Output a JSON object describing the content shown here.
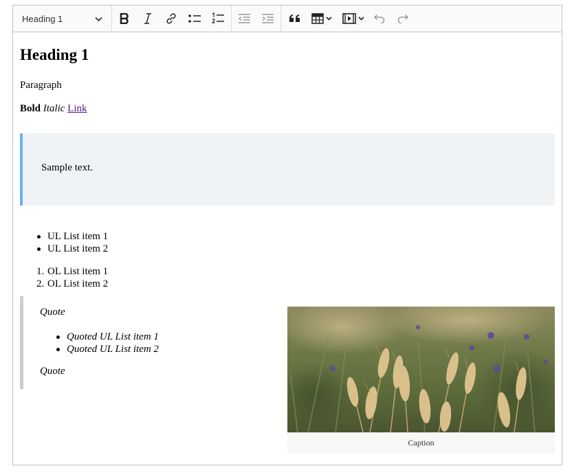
{
  "toolbar": {
    "heading_select": "Heading 1",
    "buttons": [
      "bold",
      "italic",
      "link",
      "bulleted-list",
      "numbered-list",
      "outdent",
      "indent",
      "block-quote",
      "insert-table",
      "insert-media",
      "undo",
      "redo"
    ]
  },
  "content": {
    "heading": "Heading 1",
    "paragraph": "Paragraph",
    "bold": "Bold",
    "italic": "Italic",
    "link": "Link",
    "callout_text": "Sample text.",
    "ul_items": [
      "UL List item 1",
      "UL List item 2"
    ],
    "ol_items": [
      "OL List item 1",
      "OL List item 2"
    ],
    "ol_numbers": [
      "1.",
      "2."
    ],
    "quote": {
      "line1": "Quote",
      "items": [
        "Quoted UL List item 1",
        "Quoted UL List item 2"
      ],
      "line2": "Quote"
    },
    "image_caption": "Caption"
  },
  "colors": {
    "callout_bg": "#eff3f6",
    "callout_border": "#6ab1f0",
    "quote_border": "#cccccc",
    "link": "#551a8b"
  }
}
